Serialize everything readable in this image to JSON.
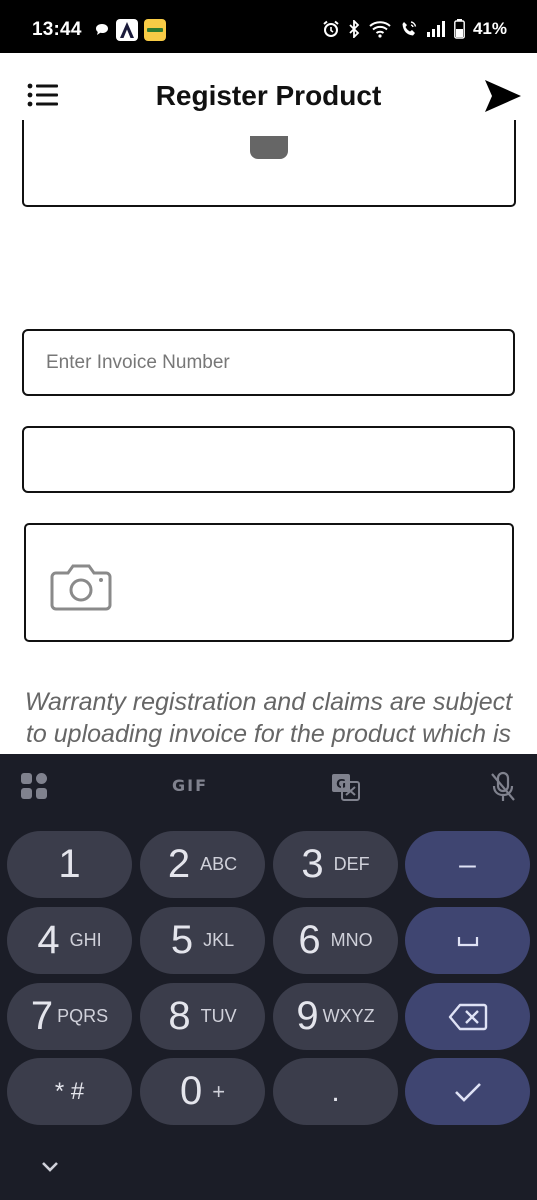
{
  "status_bar": {
    "time": "13:44",
    "battery": "41%",
    "left_icons": [
      "chat-bubble-icon",
      "app-a-icon",
      "blinkit-icon"
    ],
    "right_icons": [
      "alarm-icon",
      "bluetooth-icon",
      "wifi-icon",
      "wifi-calling-icon",
      "signal-icon",
      "battery-icon"
    ]
  },
  "header": {
    "title": "Register Product",
    "menu_icon": "list-menu-icon",
    "send_icon": "send-icon"
  },
  "form": {
    "invoice_placeholder": "Enter Invoice Number",
    "invoice_value": "",
    "second_value": "",
    "upload_icon": "camera-icon",
    "note_lines": [
      "Warranty registration and claims are subject",
      "to uploading invoice for the product which is"
    ]
  },
  "keyboard": {
    "toolbar": {
      "apps_icon": "grid-apps-icon",
      "gif_label": "GIF",
      "translate_icon": "translate-icon",
      "mic_icon": "mic-off-icon"
    },
    "keys": {
      "k1": {
        "main": "1",
        "sub": ""
      },
      "k2": {
        "main": "2",
        "sub": "ABC"
      },
      "k3": {
        "main": "3",
        "sub": "DEF"
      },
      "k4": {
        "main": "4",
        "sub": "GHI"
      },
      "k5": {
        "main": "5",
        "sub": "JKL"
      },
      "k6": {
        "main": "6",
        "sub": "MNO"
      },
      "k7": {
        "main": "7",
        "sub": "PQRS"
      },
      "k8": {
        "main": "8",
        "sub": "TUV"
      },
      "k9": {
        "main": "9",
        "sub": "WXYZ"
      },
      "k0": {
        "main": "0",
        "sub": "+"
      },
      "star_hash": "* #",
      "dot": ".",
      "minus": "–"
    },
    "action_icons": [
      "space-icon",
      "backspace-icon",
      "checkmark-icon"
    ],
    "hide_icon": "chevron-down-icon"
  },
  "colors": {
    "keyboard_bg": "#1b1d27",
    "key_bg": "#3b3d4b",
    "action_key_bg": "#3f4571"
  }
}
